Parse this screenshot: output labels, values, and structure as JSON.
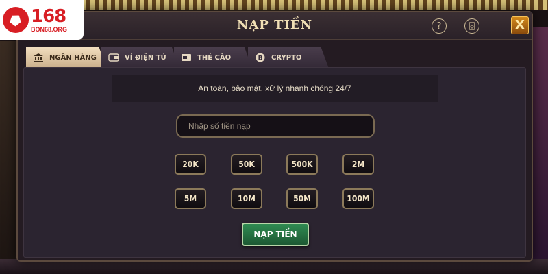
{
  "brand": {
    "logo_number": "168",
    "logo_sub": "BON68.ORG"
  },
  "dialog": {
    "title": "NẠP TIỀN",
    "help_icon": "help-icon",
    "history_icon": "history-icon",
    "close_label": "X"
  },
  "tabs": [
    {
      "label": "NGÂN HÀNG",
      "icon": "bank-icon",
      "active": true
    },
    {
      "label": "VÍ ĐIỆN TỬ",
      "icon": "wallet-icon",
      "active": false
    },
    {
      "label": "THẺ CÀO",
      "icon": "card-icon",
      "active": false
    },
    {
      "label": "CRYPTO",
      "icon": "bitcoin-icon",
      "active": false
    }
  ],
  "info": {
    "text": "An toàn, bảo mật, xử lý nhanh chóng 24/7"
  },
  "amount": {
    "placeholder": "Nhập số tiền nạp",
    "value": ""
  },
  "presets": [
    "20K",
    "50K",
    "500K",
    "2M",
    "5M",
    "10M",
    "50M",
    "100M"
  ],
  "submit_label": "NẠP TIỀN",
  "colors": {
    "accent_gold": "#f0dfb5",
    "submit_green": "#2f8b52",
    "close_orange": "#d48a1c"
  }
}
